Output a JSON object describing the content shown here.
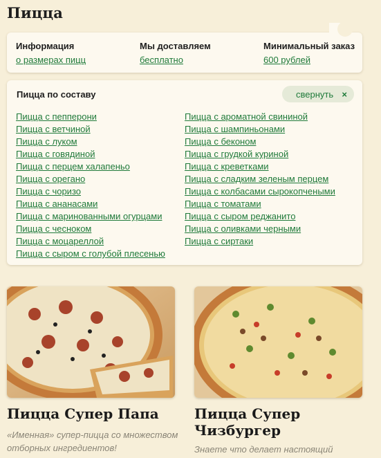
{
  "page": {
    "title": "Пицца"
  },
  "info": {
    "columns": [
      {
        "heading": "Информация",
        "link": "о размерах пицц"
      },
      {
        "heading": "Мы доставляем",
        "link": "бесплатно"
      },
      {
        "heading": "Минимальный заказ",
        "link": "600 рублей"
      }
    ]
  },
  "composition": {
    "title": "Пицца по составу",
    "collapse_label": "свернуть",
    "collapse_icon": "×",
    "left": [
      "Пицца с пепперони",
      "Пицца с ветчиной",
      "Пицца с луком",
      "Пицца с говядиной",
      "Пицца с перцем халапеньо",
      "Пицца с орегано",
      "Пицца с чоризо",
      "Пицца с ананасами",
      "Пицца с маринованными огурцами",
      "Пицца с чесноком",
      "Пицца с моцареллой",
      "Пицца с сыром с голубой плесенью"
    ],
    "right": [
      "Пицца с ароматной свининой",
      "Пицца с шампиньонами",
      "Пицца с беконом",
      "Пицца с грудкой куриной",
      "Пицца с креветками",
      "Пицца с сладким зеленым перцем",
      "Пицца с колбасами сырокопчеными",
      "Пицца с томатами",
      "Пицца с сыром реджанито",
      "Пицца с оливками черными",
      "Пицца с сиртаки"
    ]
  },
  "products": [
    {
      "name": "Пицца Супер Папа",
      "desc": "«Именная» супер-пицца со множеством отборных ингредиентов!"
    },
    {
      "name": "Пицца Супер Чизбургер",
      "desc": "Знаете что делает настоящий"
    }
  ],
  "colors": {
    "background": "#f7efd9",
    "card": "#fdf9ef",
    "link": "#1f7a3a",
    "collapse_bg": "#e5ead8"
  }
}
